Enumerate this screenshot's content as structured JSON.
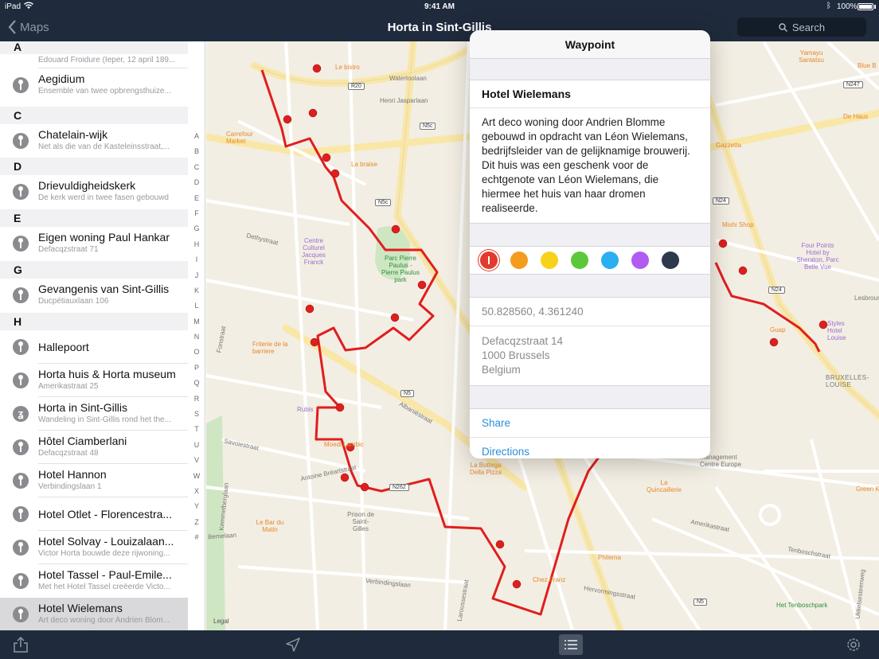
{
  "status_bar": {
    "carrier": "iPad",
    "time": "9:41 AM",
    "battery": "100%"
  },
  "nav": {
    "back_label": "Maps",
    "title": "Horta in Sint-Gillis",
    "search_placeholder": "Search"
  },
  "sidebar": {
    "top_partial": {
      "header": "A",
      "sub": "Edouard Froidure (Ieper, 12 april 189..."
    },
    "sections": [
      {
        "header": "C"
      },
      {
        "header": "D"
      },
      {
        "header": "E"
      },
      {
        "header": "G"
      },
      {
        "header": "H"
      }
    ],
    "items": [
      {
        "title": "Aegidium",
        "sub": "Ensemble van twee opbrengsthuize..."
      },
      {
        "title": "Chatelain-wijk",
        "sub": "Net als die van de Kasteleinsstraat,..."
      },
      {
        "title": "Drievuldigheidskerk",
        "sub": "De kerk werd in twee fasen gebouwd"
      },
      {
        "title": "Eigen woning Paul Hankar",
        "sub": "Defacqzstraat 71"
      },
      {
        "title": "Gevangenis van Sint-Gillis",
        "sub": "Ducpétiauxlaan 106"
      },
      {
        "title": "Hallepoort",
        "sub": ""
      },
      {
        "title": "Horta huis & Horta museum",
        "sub": "Amerikastraat 25"
      },
      {
        "title": "Horta in Sint-Gillis",
        "sub": "Wandeling in Sint-Gillis rond het the..."
      },
      {
        "title": "Hôtel Ciamberlani",
        "sub": "Defacqzstraat 48"
      },
      {
        "title": "Hotel Hannon",
        "sub": "Verbindingslaan 1"
      },
      {
        "title": "Hotel Otlet - Florencestra...",
        "sub": ""
      },
      {
        "title": "Hotel Solvay - Louizalaan...",
        "sub": "Victor Horta bouwde deze rijwoning..."
      },
      {
        "title": "Hotel Tassel - Paul-Emile...",
        "sub": "Met het Hotel Tassel creëerde Victo..."
      },
      {
        "title": "Hotel Wielemans",
        "sub": "Art deco woning door Andrien Blom..."
      }
    ],
    "index_letters": [
      "A",
      "B",
      "C",
      "D",
      "E",
      "F",
      "G",
      "H",
      "I",
      "J",
      "K",
      "L",
      "M",
      "N",
      "O",
      "P",
      "Q",
      "R",
      "S",
      "T",
      "U",
      "V",
      "W",
      "X",
      "Y",
      "Z",
      "#"
    ]
  },
  "map": {
    "labels": {
      "henri_jaspar": "Henri Jasparlaan",
      "waterloo": "Waterloolaan",
      "le_bistro": "Le bistro",
      "carrefour": "Carrefour Market",
      "la_braise": "La braise",
      "centre_culturel": "Centre Culturel Jacques Franck",
      "parc": "Parc Pierre Paulus - Pierre Paulus park",
      "friterie": "Friterie de la barriere",
      "rubis": "Rubis",
      "moedi": "Moedi Lambic",
      "la_bottega": "La Bottega Della Pizza",
      "prison": "Prison de Saint-Gilles",
      "le_bar": "Le Bar du Matin",
      "chez_franz": "Chez Franz",
      "philema": "Philema",
      "la_quincaillerie": "La Quincaillerie",
      "management": "Management Centre Europe",
      "het_tenbosch": "Het Tenboschpark",
      "yamayu": "Yamayu Santatsu",
      "de_haus": "De Haus",
      "gazzetta": "Gazzetta",
      "mishi": "Mishi Shop",
      "four_points": "Four Points Hotel by Sheraton, Parc Belle Vue",
      "styles": "Styles Hotel Louise",
      "guap": "Guap",
      "blue_b": "Blue B",
      "bruxelles_louise": "BRUXELLES-LOUISE",
      "green_k": "Green K",
      "dethystraat": "Dethystraat",
      "fontstraat": "Fonstraat",
      "savoiestraat": "Savoiestraat",
      "bearstraat": "Antoine Bréartstraat",
      "albaniestraat": "Albaniëstraat",
      "kemmelberglaan": "Kemmelberglaan",
      "verbindingslaan": "Verbindingslaan",
      "larousse": "Laroussestraat",
      "beemdlaan": "Bemelaan",
      "tenbosch": "Tenboschstraat",
      "lesbroussart": "Lesbroussart",
      "amerikastraat": "Amerikastraat",
      "hervormingsstraat": "Hervormingsstraat",
      "ueccle": "Ukkelsesteenweg",
      "legal": "Legal",
      "r20": "R20",
      "n5c_1": "N5c",
      "n5c_2": "N5c",
      "n5": "N5",
      "n5_2": "N5",
      "n24": "N24",
      "n24_2": "N24",
      "n247": "N247",
      "n262": "N262"
    }
  },
  "popover": {
    "title": "Waypoint",
    "name": "Hotel Wielemans",
    "description": "Art deco woning door Andrien Blomme gebouwd in opdracht van Léon Wielemans, bedrijfsleider van de gelijknamige brouwerij. Dit huis was een geschenk voor de echtgenote van Léon Wielemans, die hiermee het huis van haar dromen realiseerde.",
    "colors": [
      "#e23a2e",
      "#f39c1e",
      "#f7d21a",
      "#5ac838",
      "#2ab0f0",
      "#b05cf0",
      "#2c3a4c"
    ],
    "selected_color": "#e23a2e",
    "coordinates": "50.828560, 4.361240",
    "address_lines": [
      "Defacqzstraat 14",
      "1000 Brussels",
      "Belgium"
    ],
    "actions": {
      "share": "Share",
      "directions": "Directions"
    }
  },
  "toolbar": {
    "icons": [
      "share-icon",
      "location-arrow-icon",
      "list-icon",
      "gear-icon"
    ]
  }
}
